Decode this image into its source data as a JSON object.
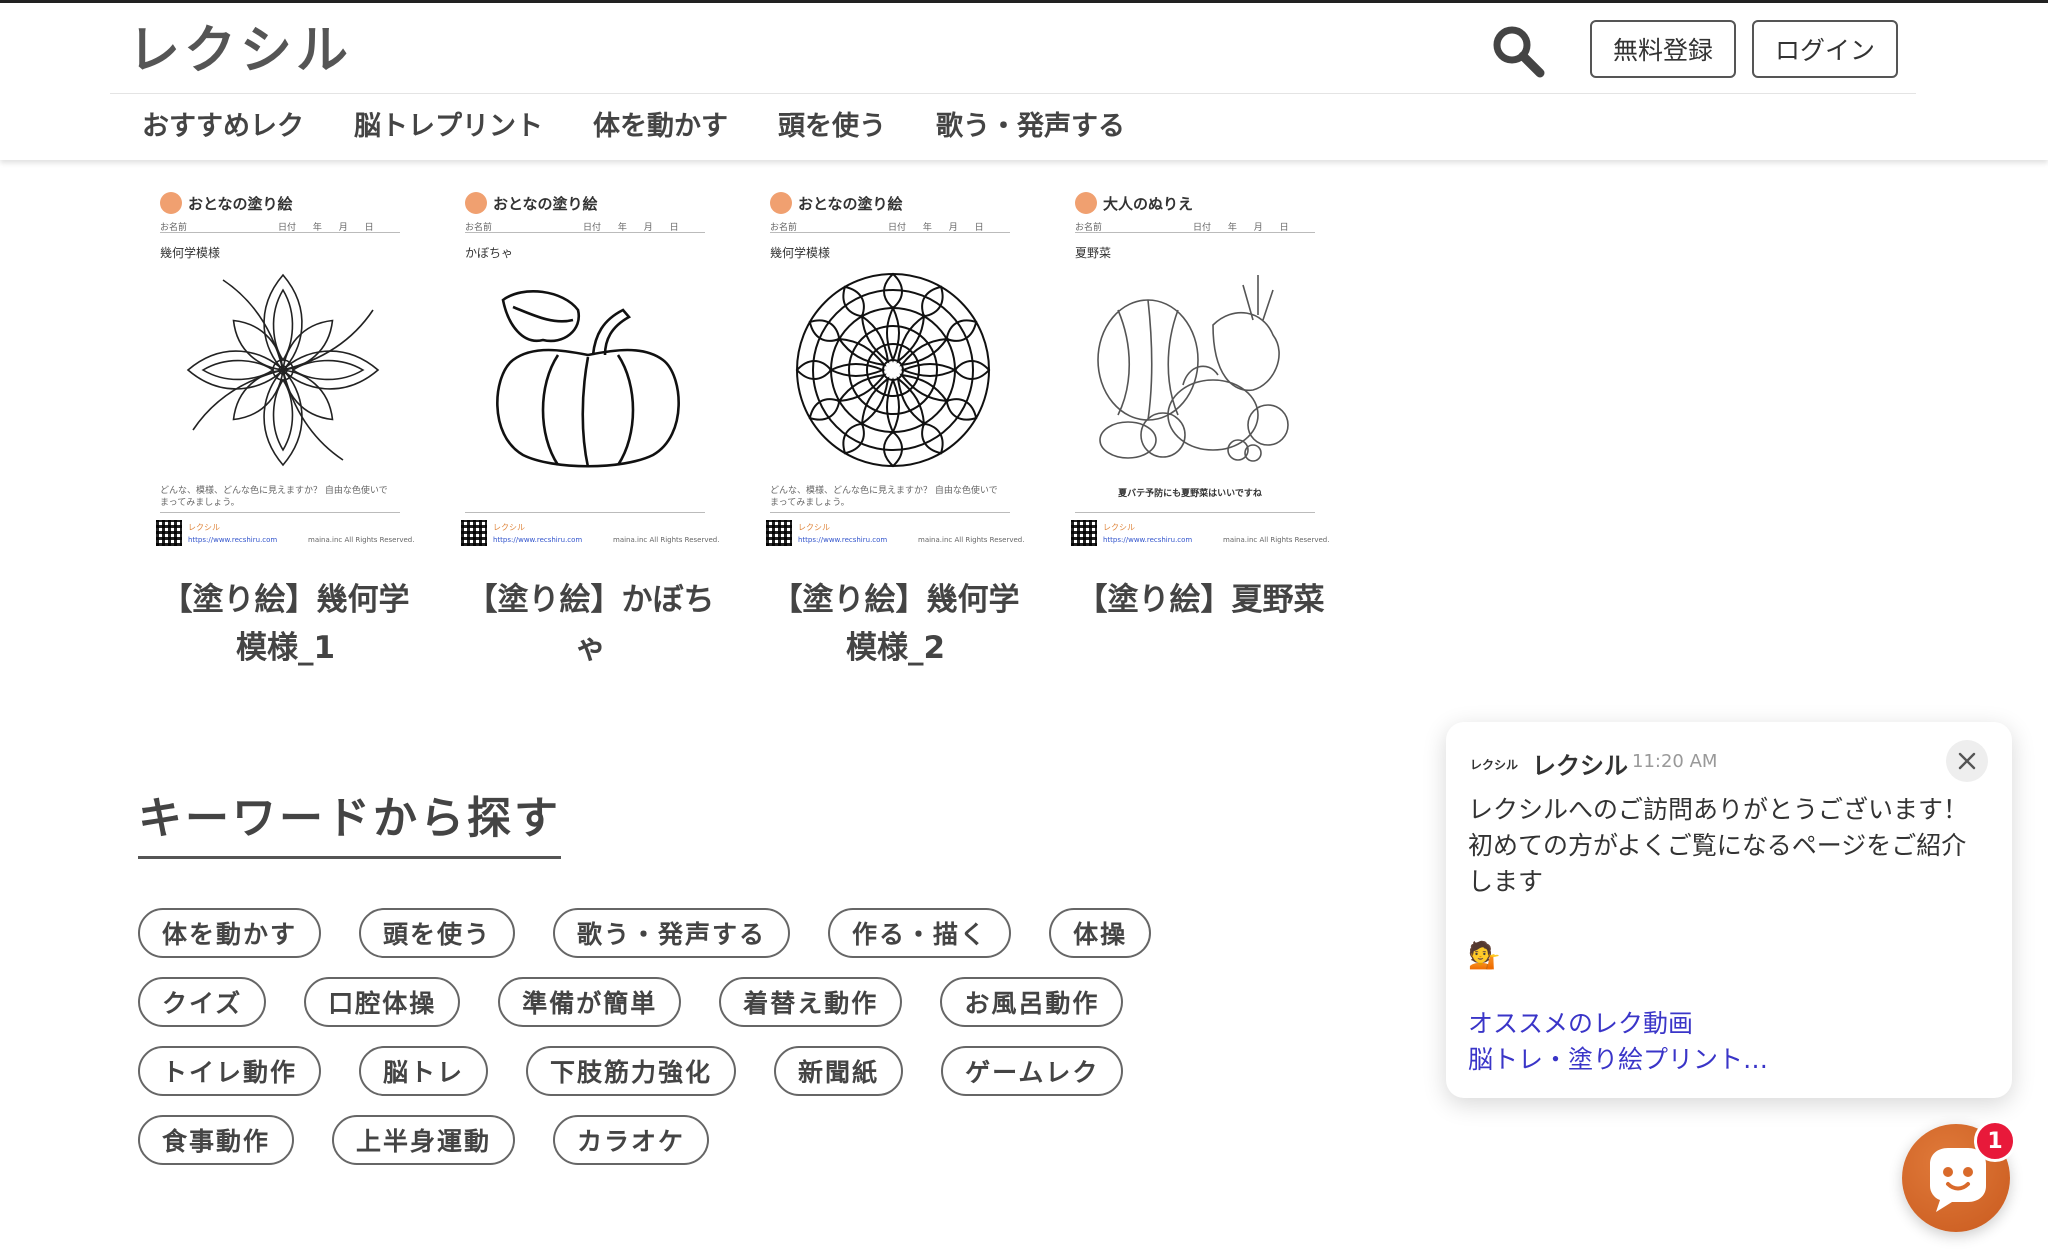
{
  "header": {
    "logo": "レクシル",
    "register_label": "無料登録",
    "login_label": "ログイン"
  },
  "nav": {
    "items": [
      {
        "label": "おすすめレク"
      },
      {
        "label": "脳トレプリント"
      },
      {
        "label": "体を動かす"
      },
      {
        "label": "頭を使う"
      },
      {
        "label": "歌う・発声する"
      }
    ]
  },
  "cards": [
    {
      "title": "【塗り絵】幾何学模様_1",
      "sheet_brand": "おとなの塗り絵",
      "sheet_subject": "幾何学模様",
      "art": "mandala-flower"
    },
    {
      "title": "【塗り絵】かぼちゃ",
      "sheet_brand": "おとなの塗り絵",
      "sheet_subject": "かぼちゃ",
      "art": "pumpkin"
    },
    {
      "title": "【塗り絵】幾何学模様_2",
      "sheet_brand": "おとなの塗り絵",
      "sheet_subject": "幾何学模様",
      "art": "mandala-round"
    },
    {
      "title": "【塗り絵】夏野菜",
      "sheet_brand": "大人のぬりえ",
      "sheet_subject": "夏野菜",
      "sheet_caption": "夏バテ予防にも夏野菜はいいですね",
      "art": "vegetables"
    }
  ],
  "sheet_common": {
    "name_label": "お名前",
    "date_label": "日付 年 月 日",
    "caption": "どんな、模様、どんな色に見えますか？ 自由な色使いでまってみましょう。",
    "footer_brand": "レクシル",
    "url": "https://www.recshiru.com",
    "copyright": "maina.inc All Rights Reserved."
  },
  "keywords": {
    "heading": "キーワードから探す",
    "rows": [
      [
        "体を動かす",
        "頭を使う",
        "歌う・発声する",
        "作る・描く",
        "体操"
      ],
      [
        "クイズ",
        "口腔体操",
        "準備が簡単",
        "着替え動作",
        "お風呂動作"
      ],
      [
        "トイレ動作",
        "脳トレ",
        "下肢筋力強化",
        "新聞紙",
        "ゲームレク"
      ],
      [
        "食事動作",
        "上半身運動",
        "カラオケ"
      ]
    ]
  },
  "chat": {
    "logo_text": "レクシル",
    "sender": "レクシル",
    "time": "11:20 AM",
    "message": "レクシルへのご訪問ありがとうございます！ 初めての方がよくご覧になるページをご紹介します",
    "emoji": "💁",
    "links": [
      "オススメのレク動画",
      "脳トレ・塗り絵プリント…"
    ],
    "unread_count": "1"
  },
  "colors": {
    "accent_orange": "#d96a2b",
    "link_blue": "#3a35c8",
    "badge_red": "#e8193a"
  }
}
